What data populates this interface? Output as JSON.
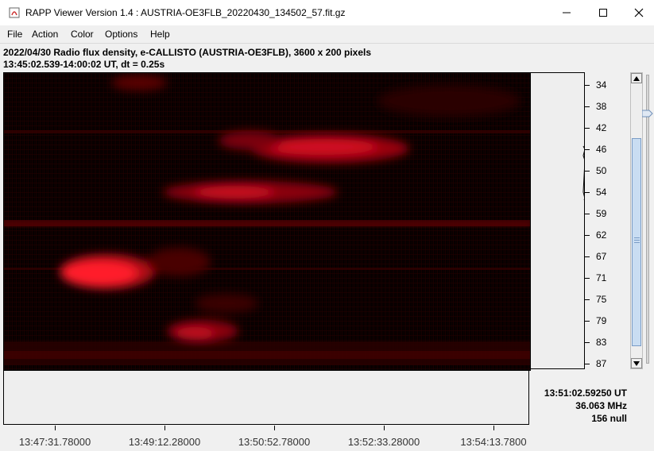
{
  "window": {
    "title": "RAPP Viewer Version 1.4 : AUSTRIA-OE3FLB_20220430_134502_57.fit.gz",
    "minimize_glyph": "—",
    "maximize_glyph": "☐",
    "close_glyph": "✕"
  },
  "menu": [
    "File",
    "Action",
    "Color",
    "Options",
    "Help"
  ],
  "info": {
    "line1": "2022/04/30  Radio flux density, e-CALLISTO (AUSTRIA-OE3FLB),  3600 x 200 pixels",
    "line2": "13:45:02.539-14:00:02 UT,  dt = 0.25s"
  },
  "chart_data": {
    "type": "heatmap",
    "title": "",
    "xlabel": "",
    "ylabel": "",
    "y_ticks": [
      "34",
      "38",
      "42",
      "46",
      "50",
      "54",
      "59",
      "62",
      "67",
      "71",
      "75",
      "79",
      "83",
      "87"
    ],
    "x_ticks": [
      "13:47:31.78000",
      "13:49:12.28000",
      "13:50:52.78000",
      "13:52:33.28000",
      "13:54:13.7800"
    ],
    "colormap": [
      "#000000",
      "#5a0000",
      "#c00010",
      "#ff2030"
    ],
    "accent_color": "#ff1a2a"
  },
  "readout": {
    "time": "13:51:02.59250 UT",
    "frequency": "36.063 MHz",
    "value": "156 null"
  }
}
